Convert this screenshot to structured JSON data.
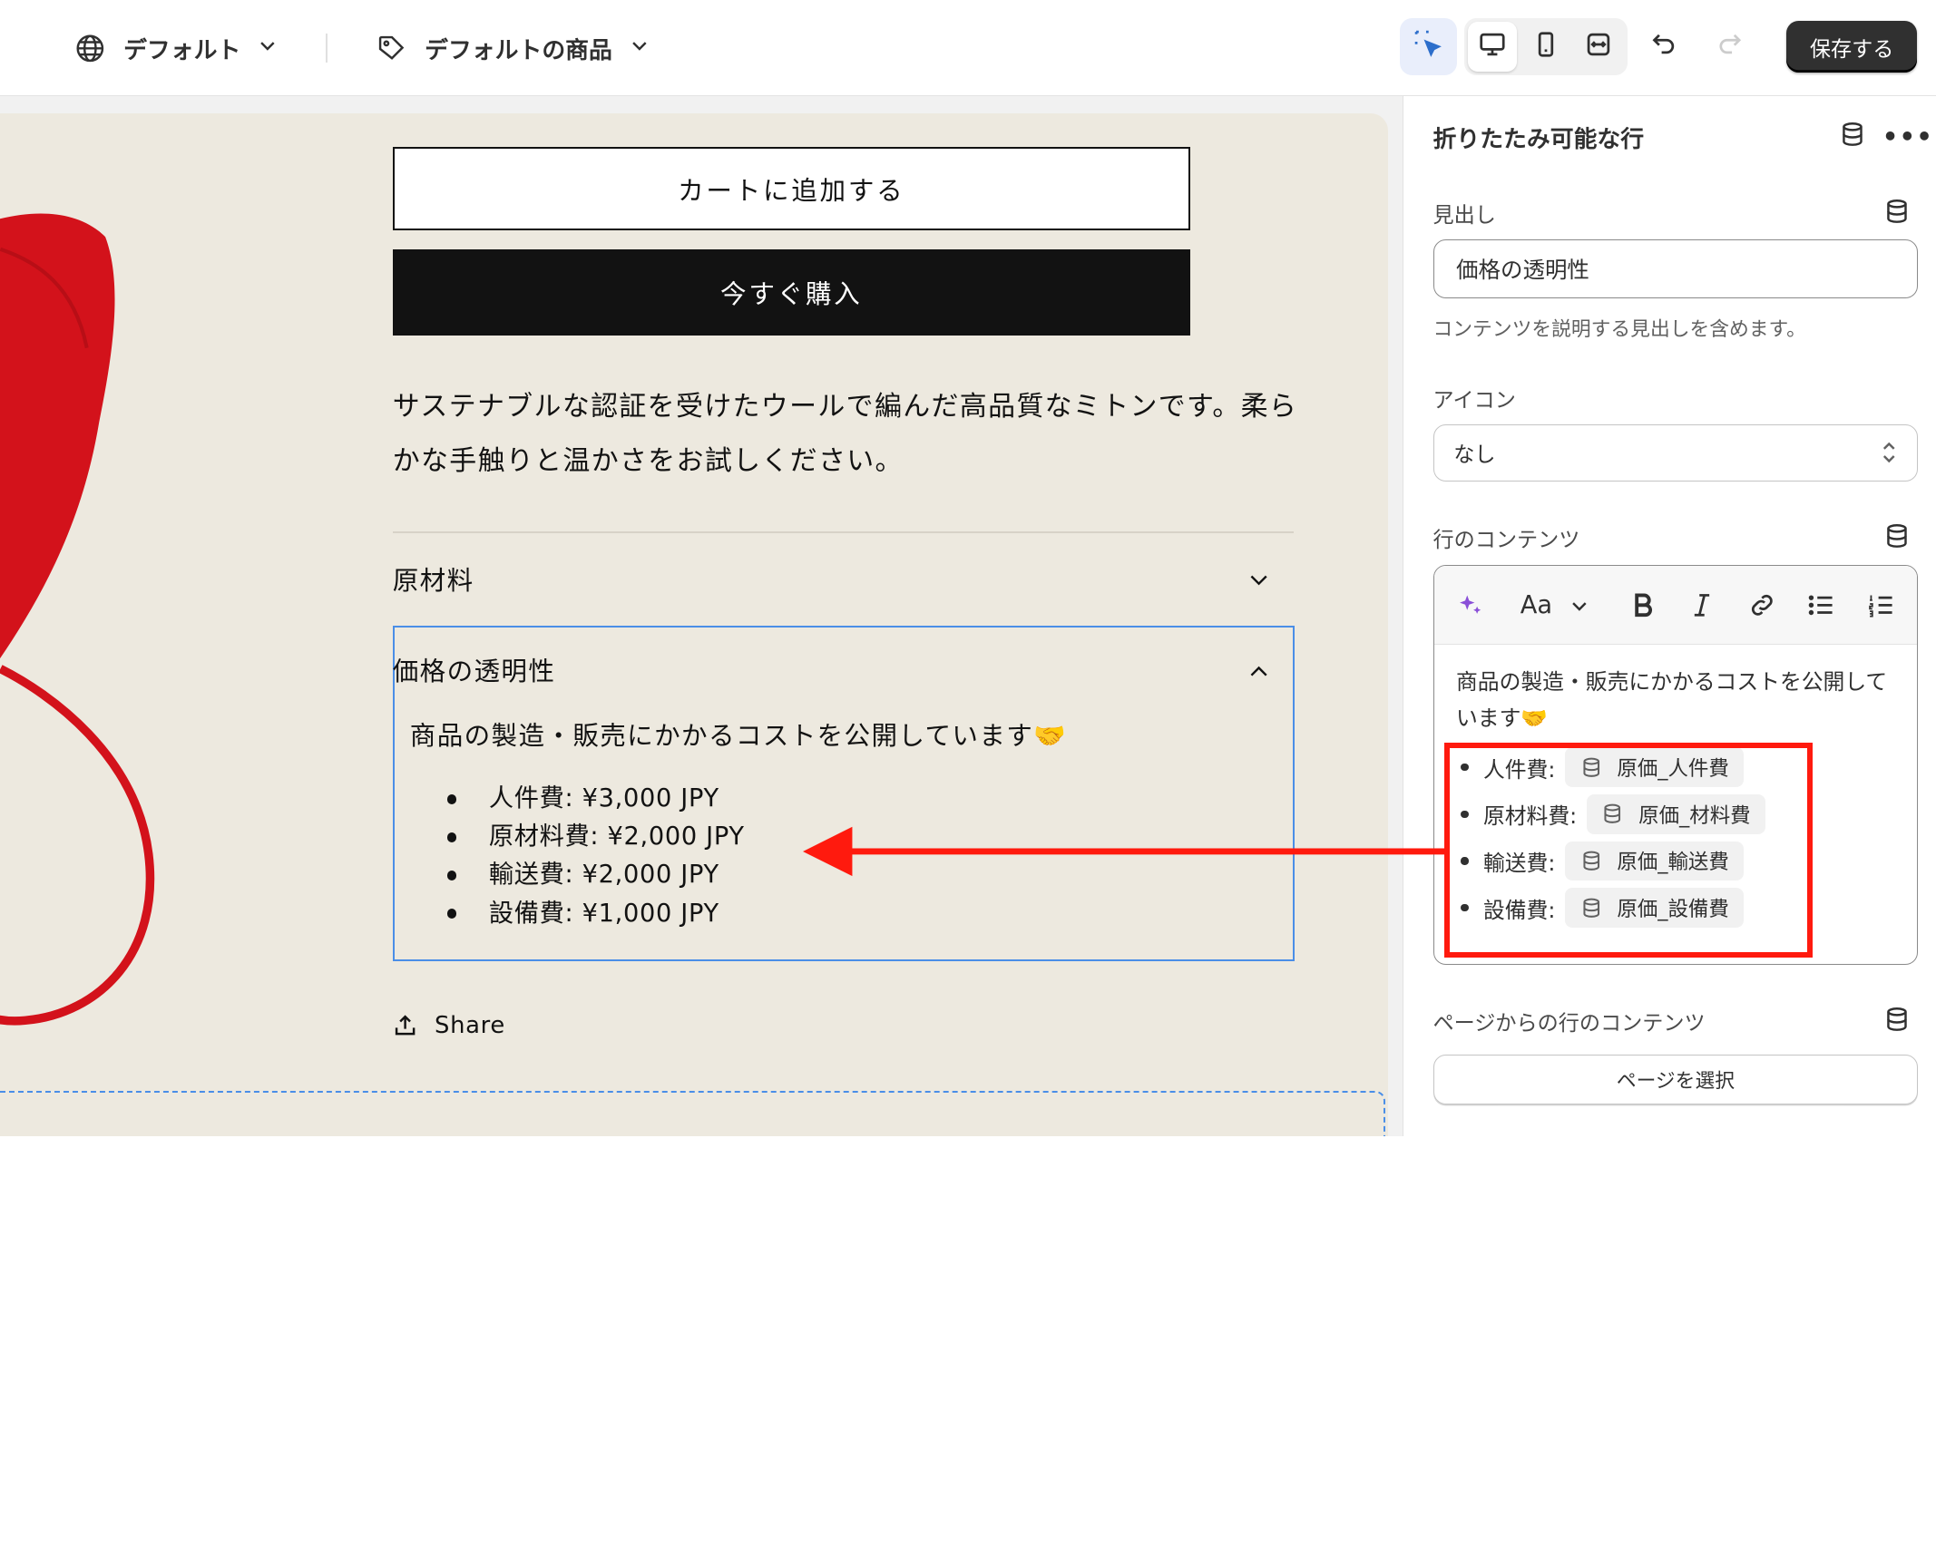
{
  "topbar": {
    "template_label": "デフォルト",
    "product_label": "デフォルトの商品",
    "save_label": "保存する"
  },
  "preview": {
    "add_to_cart": "カートに追加する",
    "buy_now": "今すぐ購入",
    "description": "サステナブルな認証を受けたウールで編んだ高品質なミトンです。柔らかな手触りと温かさをお試しください。",
    "accordion_1_title": "原材料",
    "accordion_2_title": "価格の透明性",
    "accordion_2_body": "商品の製造・販売にかかるコストを公開しています🤝",
    "cost_items": [
      "人件費: ¥3,000 JPY",
      "原材料費: ¥2,000 JPY",
      "輸送費: ¥2,000 JPY",
      "設備費: ¥1,000 JPY"
    ],
    "share_label": "Share"
  },
  "panel": {
    "title": "折りたたみ可能な行",
    "heading_label": "見出し",
    "heading_value": "価格の透明性",
    "heading_help": "コンテンツを説明する見出しを含めます。",
    "icon_label": "アイコン",
    "icon_value": "なし",
    "row_content_label": "行のコンテンツ",
    "toolbar_font_label": "Aa",
    "editor_text": "商品の製造・販売にかかるコストを公開しています🤝",
    "editor_items": [
      {
        "label": "人件費:",
        "source": "原価_人件費"
      },
      {
        "label": "原材料費:",
        "source": "原価_材料費"
      },
      {
        "label": "輸送費:",
        "source": "原価_輸送費"
      },
      {
        "label": "設備費:",
        "source": "原価_設備費"
      }
    ],
    "page_content_label": "ページからの行のコンテンツ",
    "select_page_label": "ページを選択"
  },
  "colors": {
    "annotation": "#ff1a0e",
    "selection": "#4a8ee7",
    "preview_bg": "#ede9df",
    "mitten": "#d3121b"
  }
}
